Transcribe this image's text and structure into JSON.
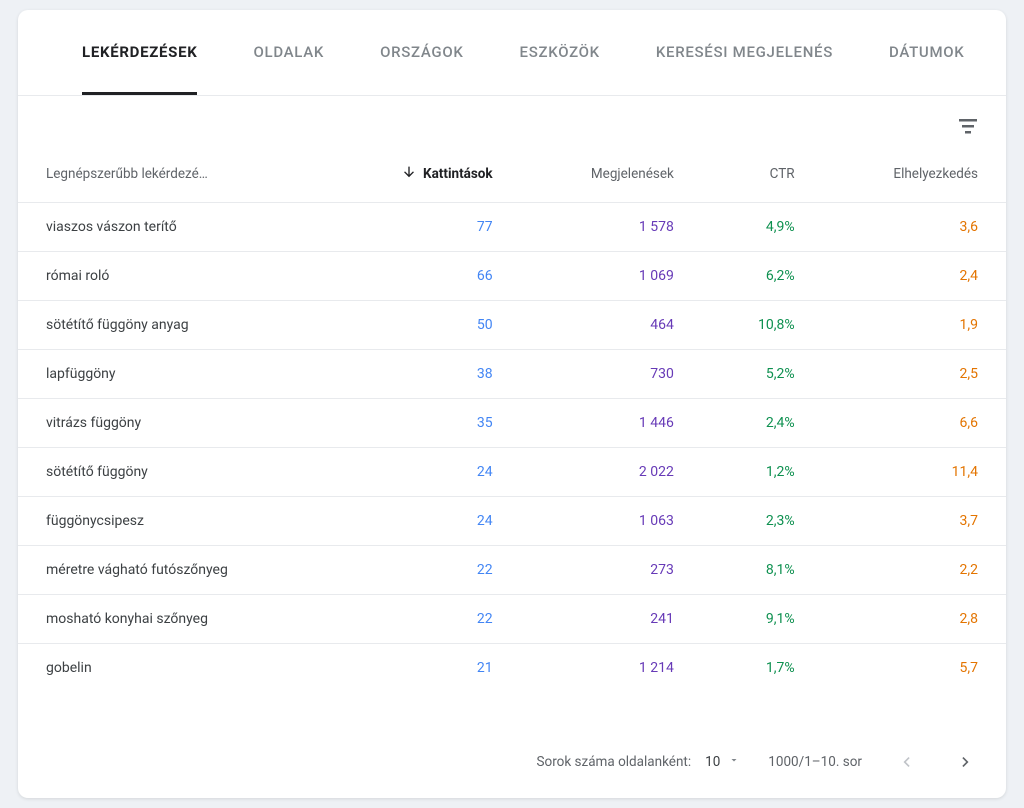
{
  "tabs": [
    {
      "label": "LEKÉRDEZÉSEK",
      "active": true
    },
    {
      "label": "OLDALAK"
    },
    {
      "label": "ORSZÁGOK"
    },
    {
      "label": "ESZKÖZÖK"
    },
    {
      "label": "KERESÉSI MEGJELENÉS"
    },
    {
      "label": "DÁTUMOK"
    }
  ],
  "columns": {
    "query": "Legnépszerűbb lekérdezé…",
    "clicks": "Kattintások",
    "impressions": "Megjelenések",
    "ctr": "CTR",
    "position": "Elhelyezkedés"
  },
  "rows": [
    {
      "query": "viaszos vászon terítő",
      "clicks": "77",
      "impressions": "1 578",
      "ctr": "4,9%",
      "position": "3,6"
    },
    {
      "query": "római roló",
      "clicks": "66",
      "impressions": "1 069",
      "ctr": "6,2%",
      "position": "2,4"
    },
    {
      "query": "sötétítő függöny anyag",
      "clicks": "50",
      "impressions": "464",
      "ctr": "10,8%",
      "position": "1,9"
    },
    {
      "query": "lapfüggöny",
      "clicks": "38",
      "impressions": "730",
      "ctr": "5,2%",
      "position": "2,5"
    },
    {
      "query": "vitrázs függöny",
      "clicks": "35",
      "impressions": "1 446",
      "ctr": "2,4%",
      "position": "6,6"
    },
    {
      "query": "sötétítő függöny",
      "clicks": "24",
      "impressions": "2 022",
      "ctr": "1,2%",
      "position": "11,4"
    },
    {
      "query": "függönycsipesz",
      "clicks": "24",
      "impressions": "1 063",
      "ctr": "2,3%",
      "position": "3,7"
    },
    {
      "query": "méretre vágható futószőnyeg",
      "clicks": "22",
      "impressions": "273",
      "ctr": "8,1%",
      "position": "2,2"
    },
    {
      "query": "mosható konyhai szőnyeg",
      "clicks": "22",
      "impressions": "241",
      "ctr": "9,1%",
      "position": "2,8"
    },
    {
      "query": "gobelin",
      "clicks": "21",
      "impressions": "1 214",
      "ctr": "1,7%",
      "position": "5,7"
    }
  ],
  "footer": {
    "rowsPerPageLabel": "Sorok száma oldalanként:",
    "rowsPerPageValue": "10",
    "rangeText": "1000/1–10. sor"
  }
}
